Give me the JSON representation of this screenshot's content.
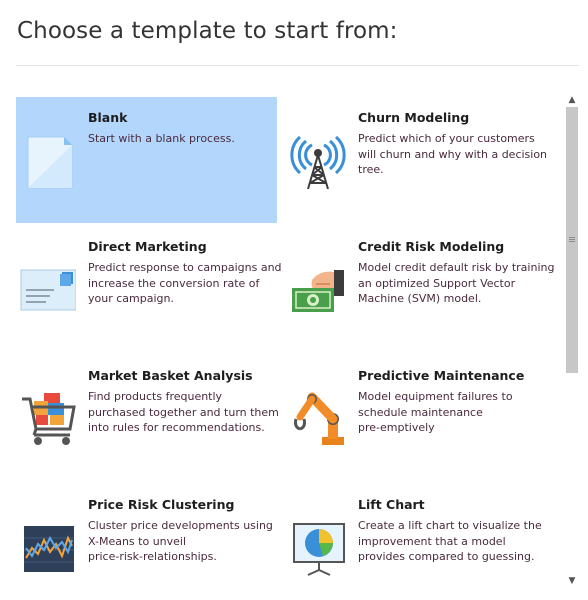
{
  "header": {
    "title": "Choose a template to start from:"
  },
  "templates": [
    {
      "title": "Blank",
      "desc": [
        "Start with a blank process."
      ],
      "icon": "blank-document-icon",
      "selected": true
    },
    {
      "title": "Churn Modeling",
      "desc": [
        "Predict which of your customers",
        "will churn and why with a decision",
        "tree."
      ],
      "icon": "signal-tower-icon",
      "selected": false
    },
    {
      "title": "Direct Marketing",
      "desc": [
        "Predict response to campaigns and",
        "increase the conversion rate of",
        "your campaign."
      ],
      "icon": "envelope-icon",
      "selected": false
    },
    {
      "title": "Credit Risk Modeling",
      "desc": [
        "Model credit default risk by training",
        "an optimized Support Vector",
        "Machine (SVM) model."
      ],
      "icon": "cash-hand-icon",
      "selected": false
    },
    {
      "title": "Market Basket Analysis",
      "desc": [
        "Find products frequently",
        "purchased together and turn them",
        "into rules for recommendations."
      ],
      "icon": "shopping-cart-icon",
      "selected": false
    },
    {
      "title": "Predictive Maintenance",
      "desc": [
        "Model equipment failures to",
        "schedule maintenance",
        "pre-emptively"
      ],
      "icon": "robot-arm-icon",
      "selected": false
    },
    {
      "title": "Price Risk Clustering",
      "desc": [
        "Cluster price developments using",
        "X-Means to unveil",
        "price-risk-relationships."
      ],
      "icon": "line-chart-icon",
      "selected": false
    },
    {
      "title": "Lift Chart",
      "desc": [
        "Create a lift chart to visualize the",
        "improvement that a model",
        "provides compared to guessing."
      ],
      "icon": "presentation-board-icon",
      "selected": false
    }
  ],
  "scrollbar": {
    "up": "▲",
    "down": "▼"
  }
}
